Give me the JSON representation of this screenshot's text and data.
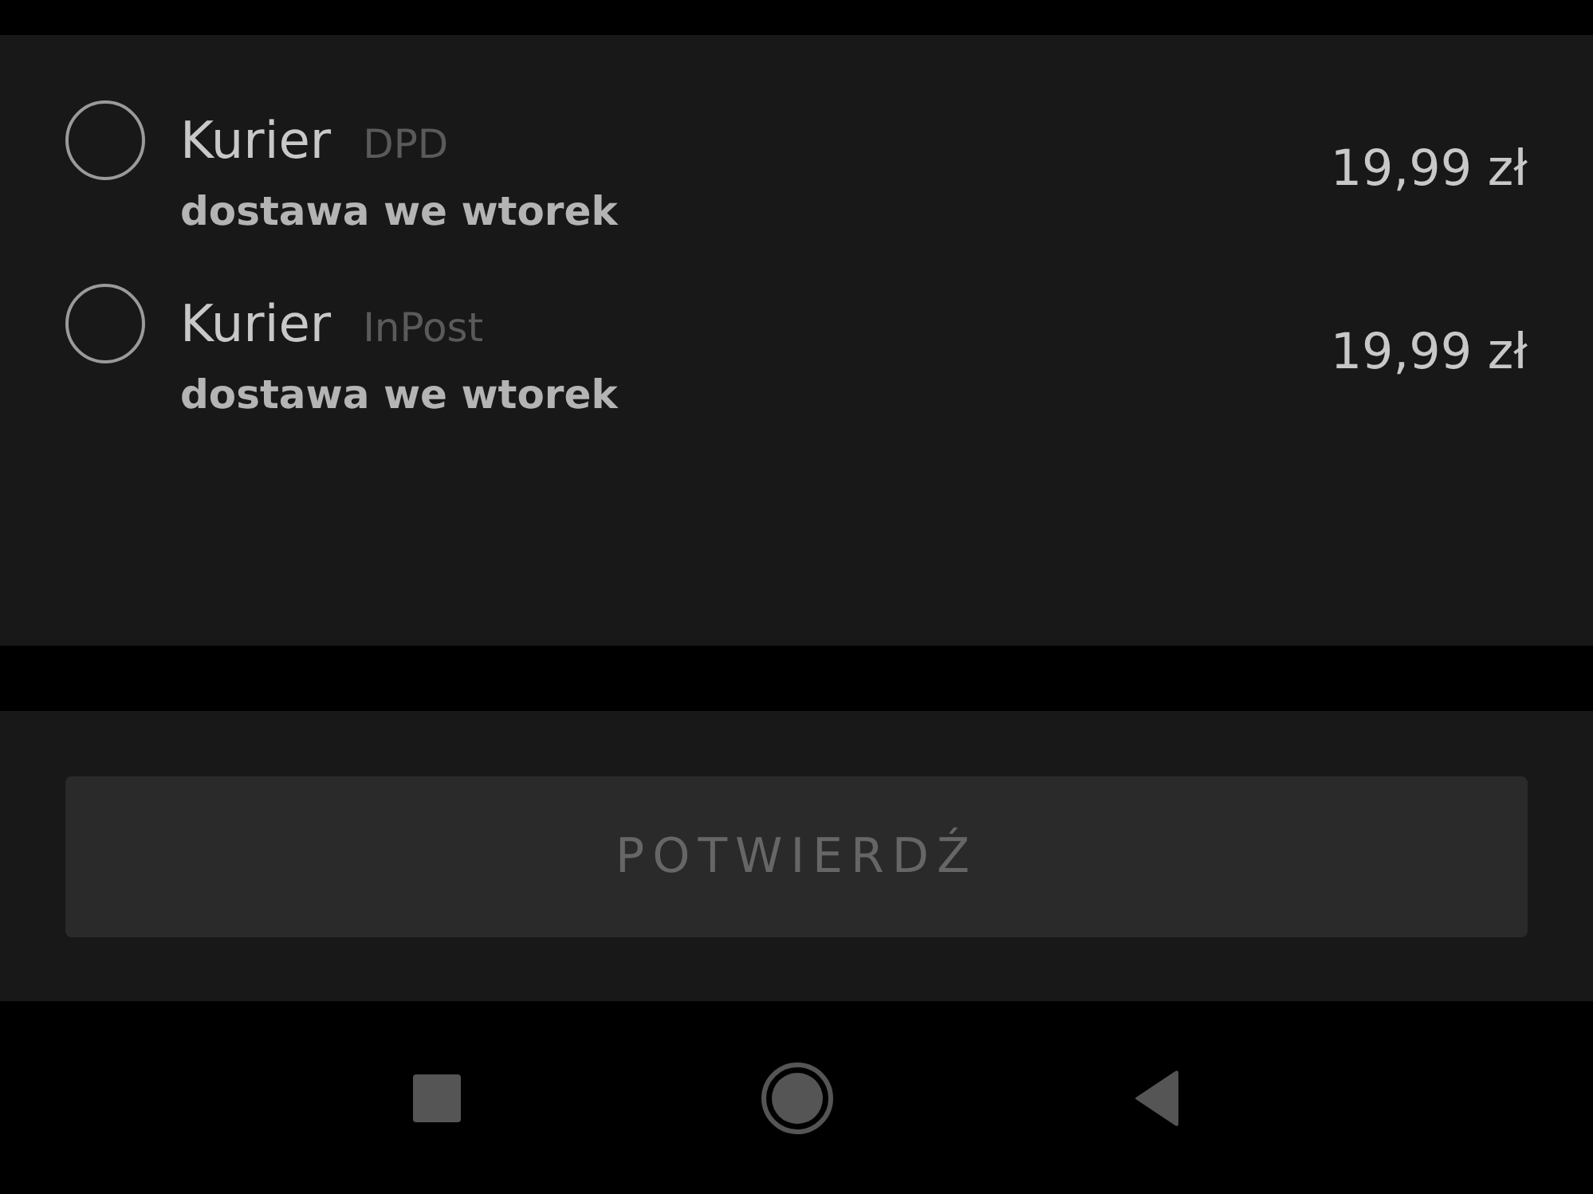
{
  "shipping_options": [
    {
      "name": "Kurier",
      "carrier": "DPD",
      "delivery": "dostawa we wtorek",
      "price": "19,99 zł",
      "selected": false
    },
    {
      "name": "Kurier",
      "carrier": "InPost",
      "delivery": "dostawa we wtorek",
      "price": "19,99 zł",
      "selected": false
    }
  ],
  "confirm_button": {
    "label": "POTWIERDŹ",
    "disabled": true
  }
}
